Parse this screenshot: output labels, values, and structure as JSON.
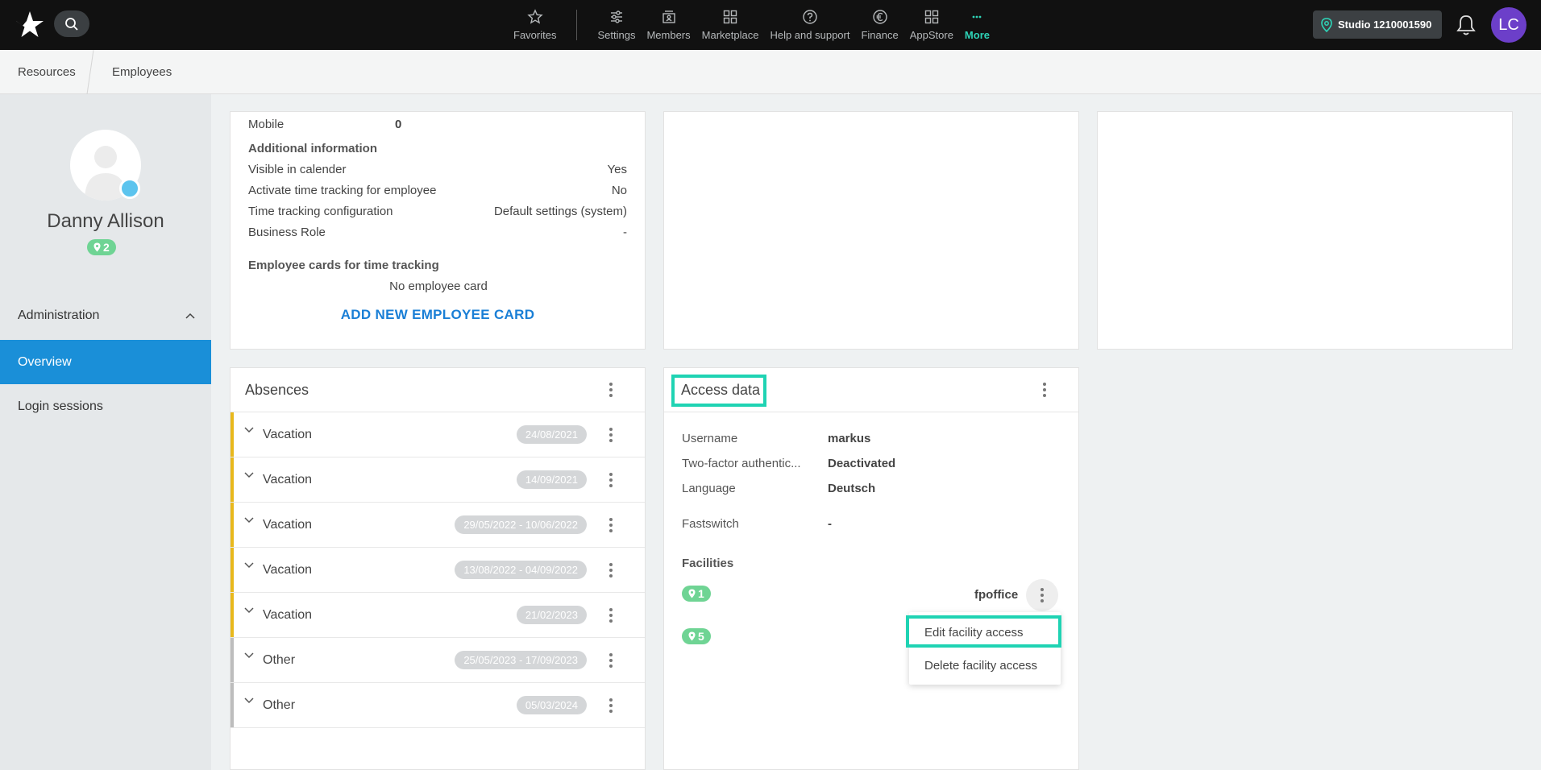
{
  "topbar": {
    "nav": [
      {
        "label": "Favorites",
        "icon": "star-icon"
      },
      {
        "label": "Settings",
        "icon": "sliders-icon"
      },
      {
        "label": "Members",
        "icon": "members-icon"
      },
      {
        "label": "Marketplace",
        "icon": "grid-icon"
      },
      {
        "label": "Help and support",
        "icon": "help-icon"
      },
      {
        "label": "Finance",
        "icon": "euro-icon"
      },
      {
        "label": "AppStore",
        "icon": "apps-icon"
      },
      {
        "label": "More",
        "icon": "dots-icon"
      }
    ],
    "studio": "Studio 1210001590",
    "avatar_initials": "LC",
    "accent": "#2ed3b7"
  },
  "breadcrumb": [
    "Resources",
    "Employees"
  ],
  "sidebar": {
    "name": "Danny Allison",
    "badge": "2",
    "section": "Administration",
    "items": [
      "Overview",
      "Login sessions"
    ]
  },
  "details": {
    "mobile_label": "Mobile",
    "mobile_value": "0",
    "additional_heading": "Additional information",
    "rows": [
      {
        "label": "Visible in calender",
        "value": "Yes"
      },
      {
        "label": "Activate time tracking for employee",
        "value": "No"
      },
      {
        "label": "Time tracking configuration",
        "value": "Default settings (system)"
      },
      {
        "label": "Business Role",
        "value": "-"
      }
    ],
    "cards_heading": "Employee cards for time tracking",
    "no_card": "No employee card",
    "add_card": "ADD NEW EMPLOYEE CARD"
  },
  "absences": {
    "title": "Absences",
    "rows": [
      {
        "label": "Vacation",
        "date": "24/08/2021",
        "color": "#e8b81c"
      },
      {
        "label": "Vacation",
        "date": "14/09/2021",
        "color": "#e8b81c"
      },
      {
        "label": "Vacation",
        "date": "29/05/2022 - 10/06/2022",
        "color": "#e8b81c"
      },
      {
        "label": "Vacation",
        "date": "13/08/2022 - 04/09/2022",
        "color": "#e8b81c"
      },
      {
        "label": "Vacation",
        "date": "21/02/2023",
        "color": "#e8b81c"
      },
      {
        "label": "Other",
        "date": "25/05/2023 - 17/09/2023",
        "color": "#bdbdbd"
      },
      {
        "label": "Other",
        "date": "05/03/2024",
        "color": "#bdbdbd"
      }
    ]
  },
  "access": {
    "title": "Access data",
    "username_label": "Username",
    "username": "markus",
    "twofa_label": "Two-factor authentic...",
    "twofa": "Deactivated",
    "language_label": "Language",
    "language": "Deutsch",
    "fastswitch_label": "Fastswitch",
    "fastswitch": "-",
    "facilities_heading": "Facilities",
    "facilities": [
      {
        "badge": "1",
        "name": "fpoffice"
      },
      {
        "badge": "5",
        "name": ""
      }
    ],
    "menu": [
      "Edit facility access",
      "Delete facility access"
    ]
  }
}
